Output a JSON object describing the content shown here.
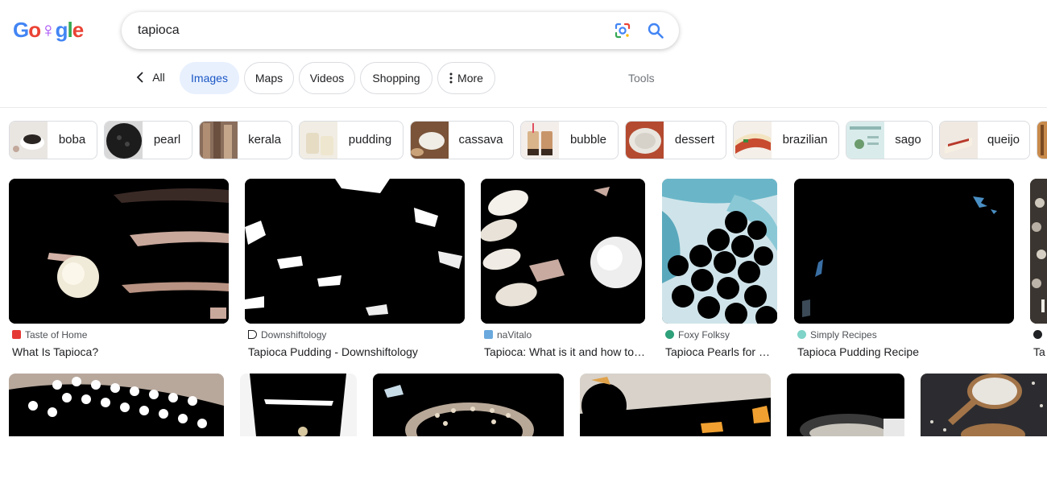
{
  "logo": {
    "letters": [
      "G",
      "o",
      "♀",
      "g",
      "l",
      "e"
    ],
    "colors": [
      "#4285f4",
      "#ea4335",
      "#a142f4",
      "#4285f4",
      "#34a853",
      "#ea4335"
    ]
  },
  "search": {
    "query": "tapioca"
  },
  "tabs": {
    "all_label": "All",
    "images_label": "Images",
    "maps_label": "Maps",
    "videos_label": "Videos",
    "shopping_label": "Shopping",
    "more_label": "More",
    "tools_label": "Tools"
  },
  "chips": [
    {
      "label": "boba"
    },
    {
      "label": "pearl"
    },
    {
      "label": "kerala"
    },
    {
      "label": "pudding"
    },
    {
      "label": "cassava"
    },
    {
      "label": "bubble"
    },
    {
      "label": "dessert"
    },
    {
      "label": "brazilian"
    },
    {
      "label": "sago"
    },
    {
      "label": "queijo"
    }
  ],
  "results": [
    {
      "source": "Taste of Home",
      "title": "What Is Tapioca?"
    },
    {
      "source": "Downshiftology",
      "title": "Tapioca Pudding - Downshiftology"
    },
    {
      "source": "naVitalo",
      "title": "Tapioca: What is it and how to use it"
    },
    {
      "source": "Foxy Folksy",
      "title": "Tapioca Pearls for Bubble Tea"
    },
    {
      "source": "Simply Recipes",
      "title": "Tapioca Pudding Recipe"
    },
    {
      "source": "",
      "title": "Ta"
    }
  ],
  "colors": {
    "accent": "#1a56c4",
    "active_tab_bg": "#e8f0fe"
  }
}
